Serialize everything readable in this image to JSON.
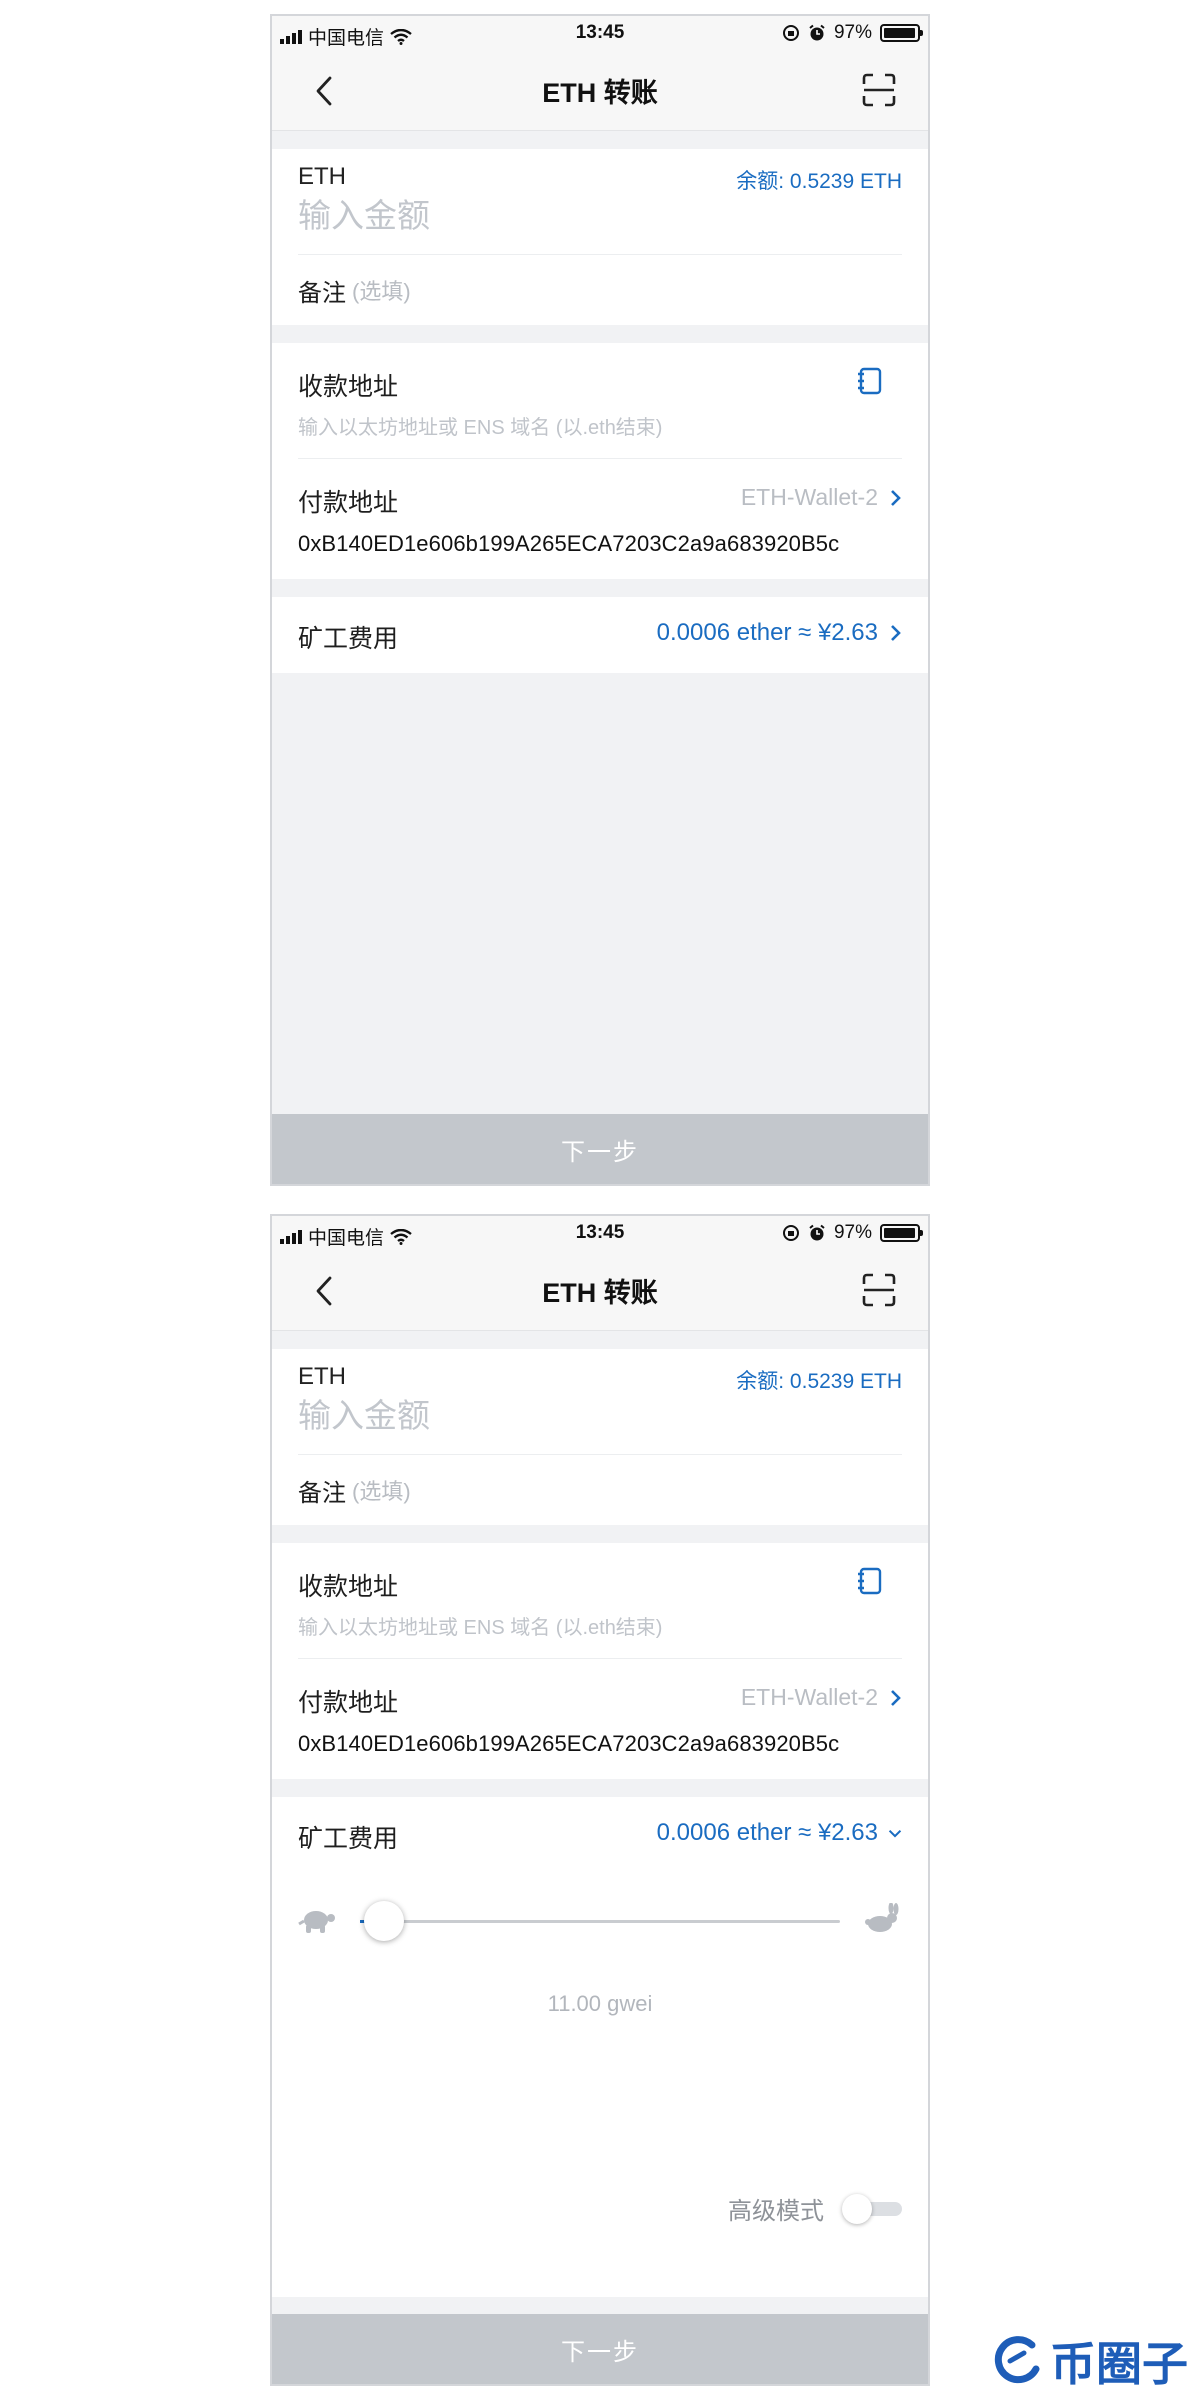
{
  "status_bar": {
    "carrier": "中国电信",
    "time": "13:45",
    "battery": "97%"
  },
  "nav": {
    "title": "ETH 转账"
  },
  "amount_section": {
    "token": "ETH",
    "balance": "余额: 0.5239 ETH",
    "amount_placeholder": "输入金额",
    "memo_label": "备注",
    "memo_optional": "(选填)"
  },
  "address_section": {
    "receive_label": "收款地址",
    "receive_placeholder": "输入以太坊地址或 ENS 域名 (以.eth结束)",
    "pay_label": "付款地址",
    "pay_wallet": "ETH-Wallet-2",
    "pay_address": "0xB140ED1e606b199A265ECA7203C2a9a683920B5c"
  },
  "fee_section": {
    "label": "矿工费用",
    "value": "0.0006 ether ≈ ¥2.63",
    "gas_price": "11.00 gwei",
    "gas_level": 0.11,
    "advanced_label": "高级模式",
    "advanced_enabled": false
  },
  "next_button": "下一步",
  "watermark": "币圈子",
  "colors": {
    "accent": "#1a6cc1",
    "button_disabled": "#c3c7cc",
    "background": "#f1f2f4"
  }
}
